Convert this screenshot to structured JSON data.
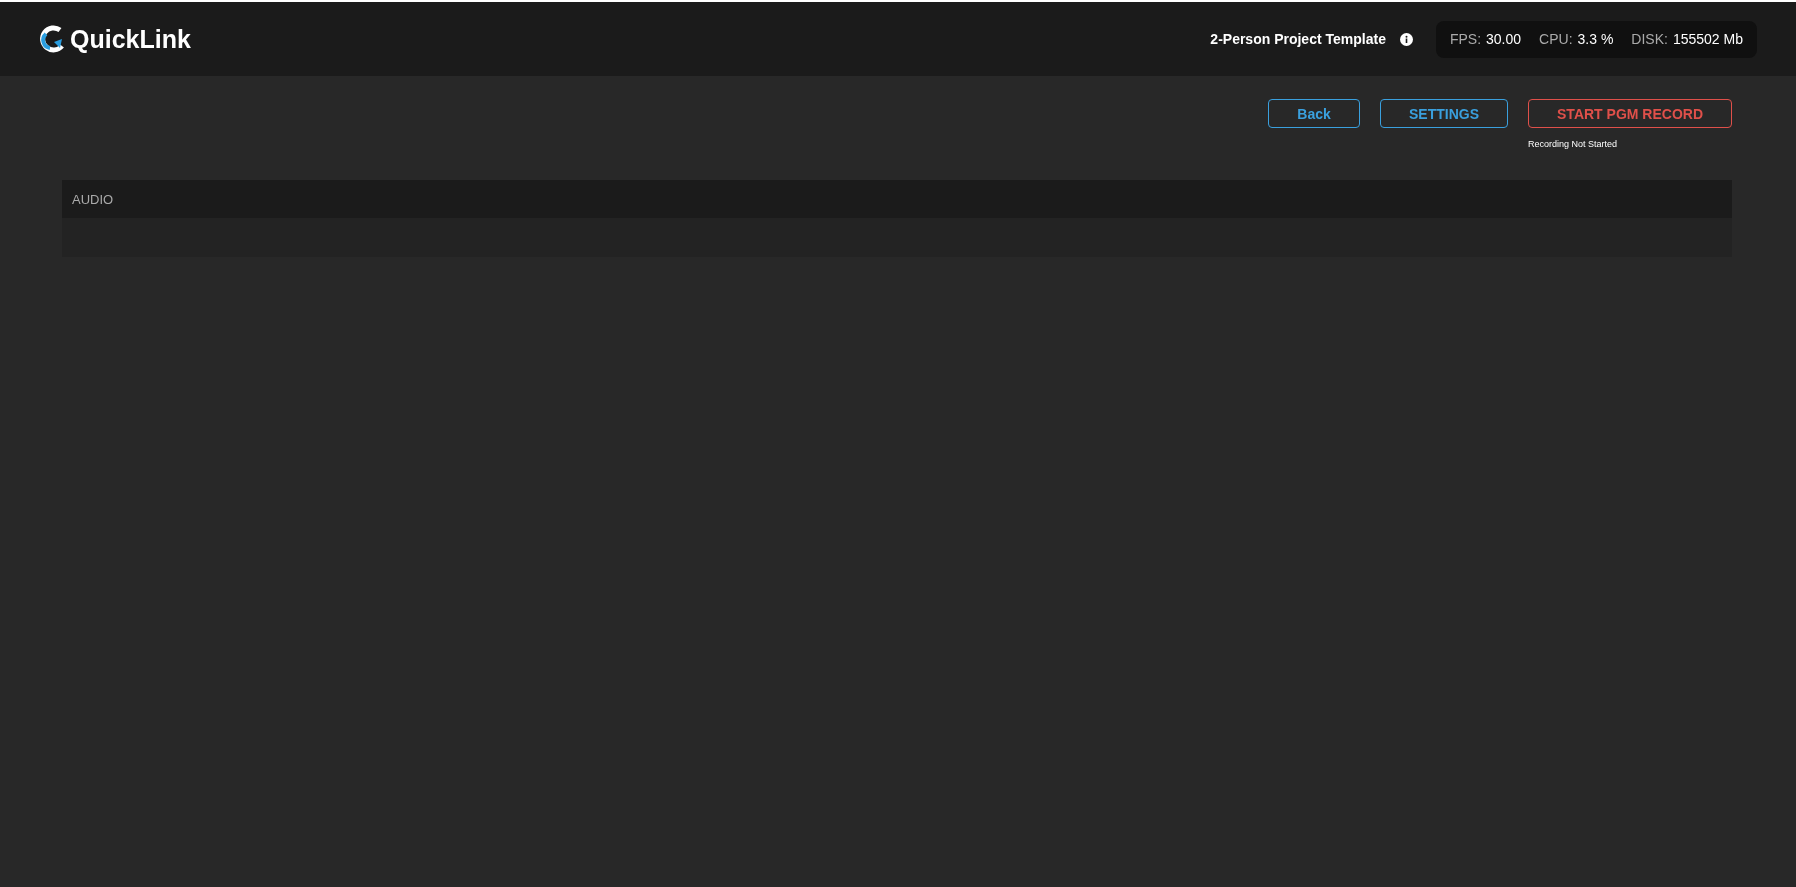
{
  "header": {
    "logo": "QuickLink",
    "project": "2-Person Project Template",
    "stats": [
      {
        "label": "FPS:",
        "value": "30.00"
      },
      {
        "label": "CPU:",
        "value": "3.3 %"
      },
      {
        "label": "DISK:",
        "value": "155502 Mb"
      }
    ]
  },
  "actions": [
    {
      "label": "Back",
      "kind": "normal"
    },
    {
      "label": "SETTINGS",
      "kind": "normal"
    },
    {
      "label": "START PGM RECORD",
      "kind": "record",
      "status": "Recording Not Started"
    }
  ],
  "panel": {
    "title": "AUDIO"
  }
}
